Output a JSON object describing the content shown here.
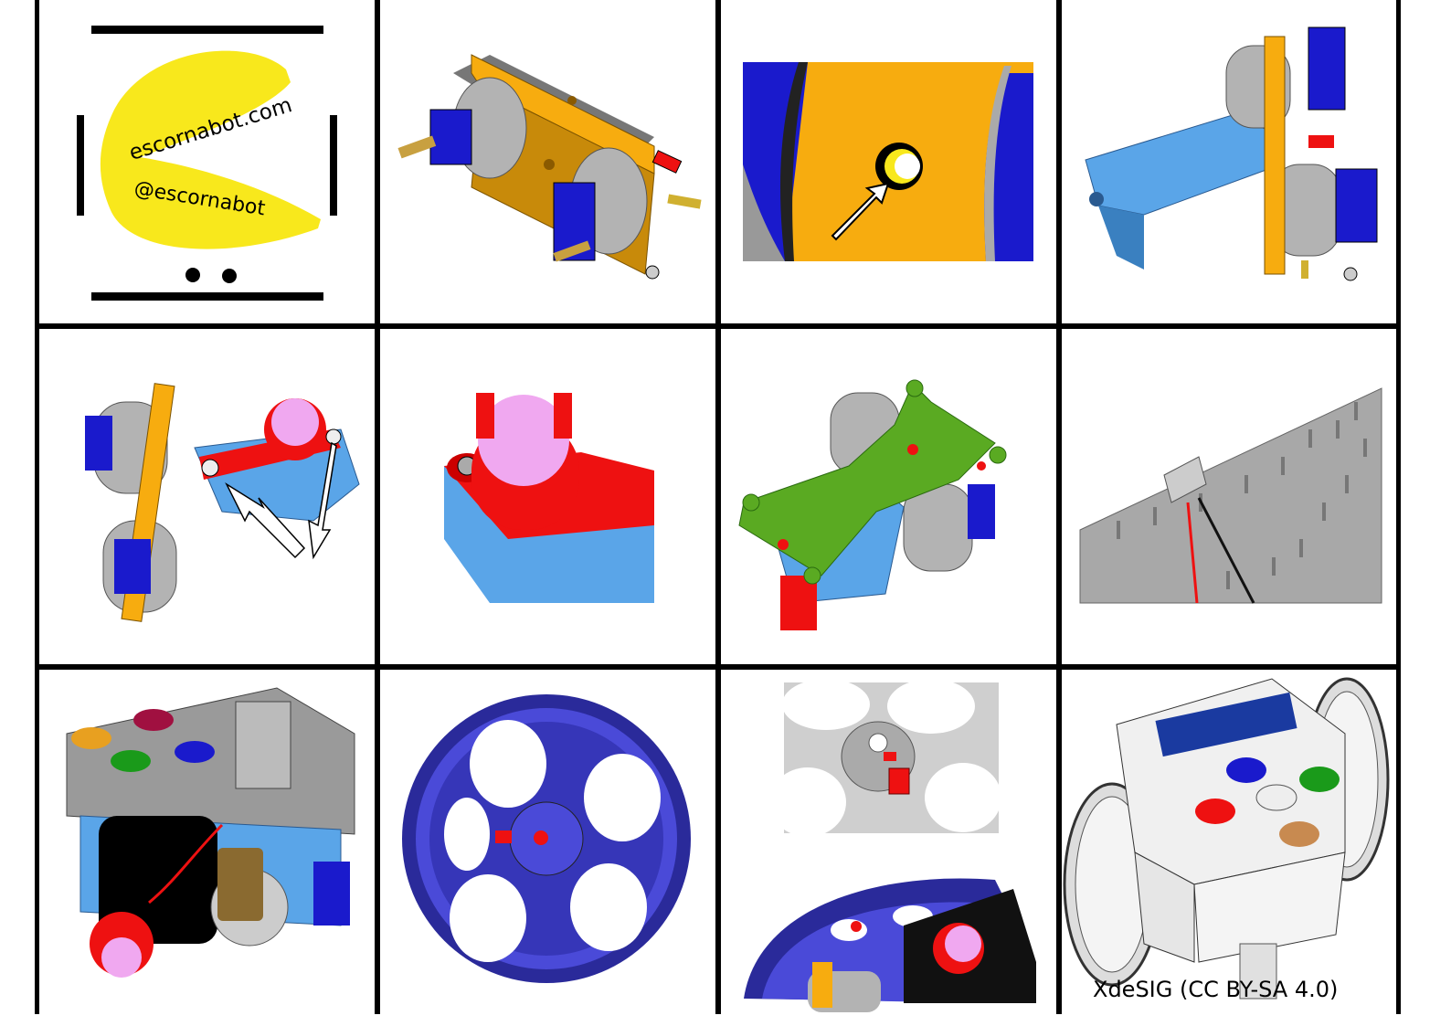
{
  "logo": {
    "website": "escornabot.com",
    "handle": "@escornabot",
    "colors": {
      "pacman": "#f8e81c",
      "ink": "#000000"
    }
  },
  "credit": "XdeSIG (CC BY-SA 4.0)",
  "colors": {
    "frame": "#f7ac0f",
    "motor": "#1a1acc",
    "gear": "#b3b3b3",
    "body": "#5aa5e8",
    "arm": "#ee1111",
    "ball": "#f0a8f0",
    "plate": "#5aaa22",
    "wheel": "#4a4ad8",
    "pcb": "#9a9a9a"
  },
  "icons": [
    "arrow-icon"
  ]
}
